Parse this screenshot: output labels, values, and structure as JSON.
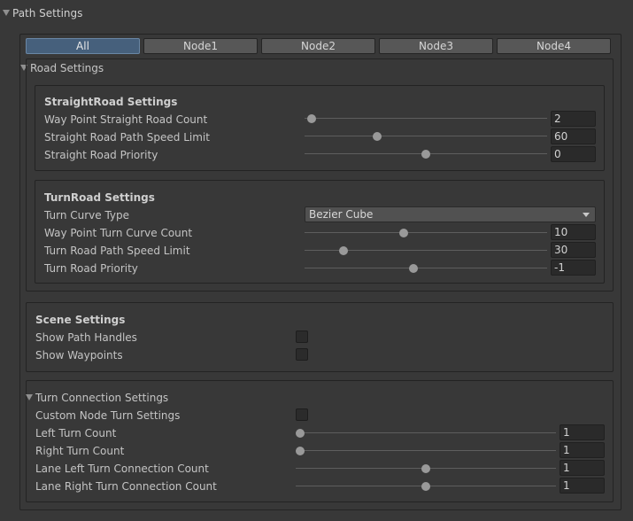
{
  "header": {
    "title": "Path Settings"
  },
  "tabs": [
    {
      "label": "All",
      "active": true
    },
    {
      "label": "Node1",
      "active": false
    },
    {
      "label": "Node2",
      "active": false
    },
    {
      "label": "Node3",
      "active": false
    },
    {
      "label": "Node4",
      "active": false
    }
  ],
  "road_settings": {
    "title": "Road Settings",
    "straight": {
      "title": "StraightRoad Settings",
      "rows": [
        {
          "label": "Way Point Straight Road Count",
          "value": "2",
          "slider_fraction": 0.03
        },
        {
          "label": "Straight Road Path Speed Limit",
          "value": "60",
          "slider_fraction": 0.3
        },
        {
          "label": "Straight Road Priority",
          "value": "0",
          "slider_fraction": 0.5
        }
      ]
    },
    "turn": {
      "title": "TurnRoad Settings",
      "curve_type_label": "Turn Curve Type",
      "curve_type_value": "Bezier Cube",
      "rows": [
        {
          "label": "Way Point Turn Curve Count",
          "value": "10",
          "slider_fraction": 0.41
        },
        {
          "label": "Turn Road Path Speed Limit",
          "value": "30",
          "slider_fraction": 0.16
        },
        {
          "label": "Turn Road Priority",
          "value": "-1",
          "slider_fraction": 0.45
        }
      ]
    }
  },
  "scene_settings": {
    "title": "Scene Settings",
    "toggles": [
      {
        "label": "Show Path Handles",
        "checked": false
      },
      {
        "label": "Show Waypoints",
        "checked": false
      }
    ]
  },
  "turn_connection": {
    "title": "Turn Connection Settings",
    "custom_toggle": {
      "label": "Custom Node Turn Settings",
      "checked": false
    },
    "rows": [
      {
        "label": "Left Turn Count",
        "value": "1",
        "slider_fraction": 0.0
      },
      {
        "label": "Right Turn Count",
        "value": "1",
        "slider_fraction": 0.0
      },
      {
        "label": "Lane Left Turn Connection Count",
        "value": "1",
        "slider_fraction": 0.5
      },
      {
        "label": "Lane Right Turn Connection Count",
        "value": "1",
        "slider_fraction": 0.5
      }
    ]
  },
  "colors": {
    "background": "#383838",
    "panel_border": "#232323",
    "active_tab": "#46607c",
    "tab": "#575757",
    "field": "#2a2a2a",
    "slider_thumb": "#999999"
  }
}
